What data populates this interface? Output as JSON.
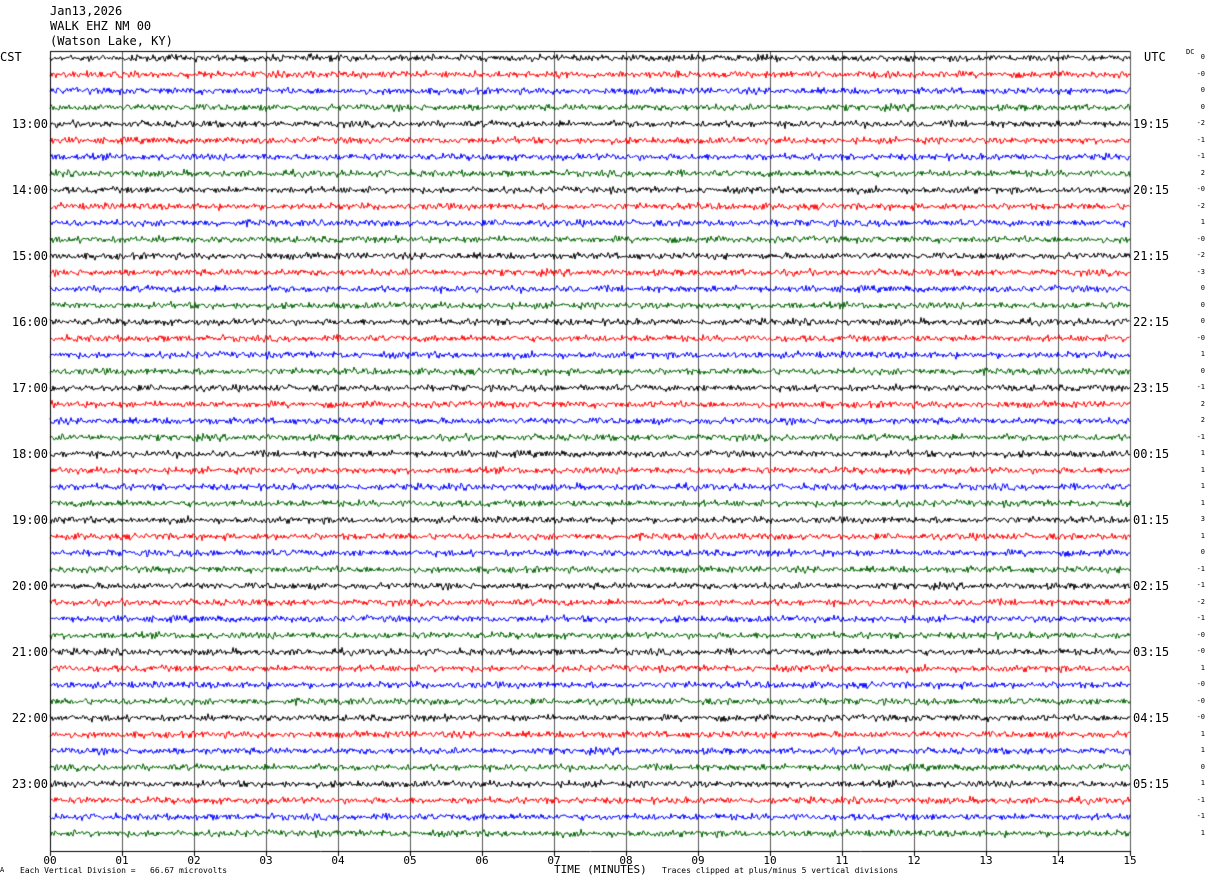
{
  "header": {
    "date": "Jan13,2026",
    "station": "WALK EHZ NM 00",
    "location": "(Watson Lake, KY)"
  },
  "labels": {
    "left_timezone": "CST",
    "right_timezone": "UTC",
    "dc_label": "DC",
    "xlabel": "TIME (MINUTES)",
    "scale_note": "Each Vertical Division =   66.67 microvolts",
    "clip_note": "Traces clipped at plus/minus 5 vertical divisions",
    "corner_mark": "A"
  },
  "colors": {
    "trace_cycle": [
      "#000000",
      "#ff0000",
      "#0000ff",
      "#006400"
    ],
    "grid": "#000000",
    "background": "#ffffff"
  },
  "chart_data": {
    "type": "line",
    "description_kind": "helicorder",
    "x_ticks": [
      "00",
      "01",
      "02",
      "03",
      "04",
      "05",
      "06",
      "07",
      "08",
      "09",
      "10",
      "11",
      "12",
      "13",
      "14",
      "15"
    ],
    "xlim": [
      0,
      15
    ],
    "left_hour_labels": [
      "13:00",
      "14:00",
      "15:00",
      "16:00",
      "17:00",
      "18:00",
      "19:00",
      "20:00",
      "21:00",
      "22:00",
      "23:00"
    ],
    "right_hour_labels": [
      "19:15",
      "20:15",
      "21:15",
      "22:15",
      "23:15",
      "00:15",
      "01:15",
      "02:15",
      "03:15",
      "04:15",
      "05:15"
    ],
    "traces_per_hour": 4,
    "trace_count": 48,
    "dc_offsets": [
      "0",
      "-0",
      "0",
      "0",
      "-2",
      "-1",
      "-1",
      "2",
      "-0",
      "-2",
      "1",
      "-0",
      "-2",
      "-3",
      "0",
      "0",
      "0",
      "-0",
      "1",
      "0",
      "-1",
      "2",
      "2",
      "-1",
      "1",
      "1",
      "1",
      "1",
      "3",
      "1",
      "0",
      "-1",
      "-1",
      "-2",
      "-1",
      "-0",
      "-0",
      "1",
      "-0",
      "-0",
      "-0",
      "1",
      "1",
      "0",
      "1",
      "-1",
      "-1",
      "1"
    ]
  }
}
